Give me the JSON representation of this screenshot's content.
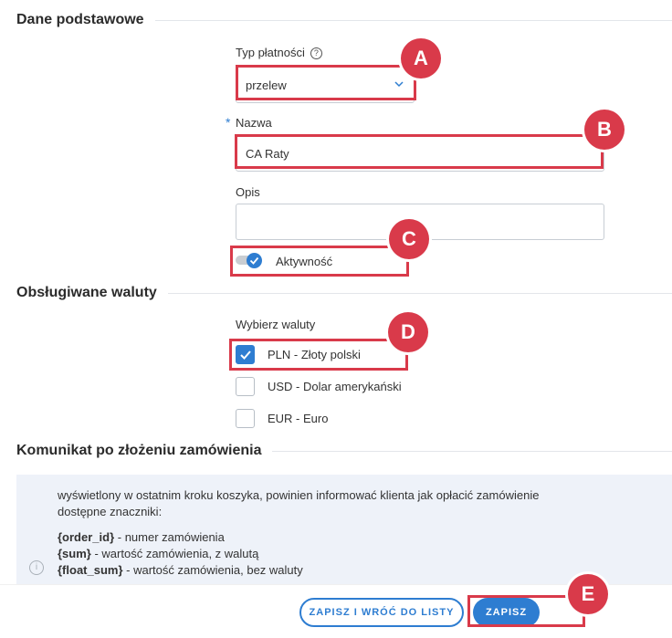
{
  "sections": {
    "basic": "Dane podstawowe",
    "currencies": "Obsługiwane waluty",
    "message": "Komunikat po złożeniu zamówienia"
  },
  "fields": {
    "payment_type_label": "Typ płatności",
    "payment_type_help": "?",
    "payment_type_value": "przelew",
    "name_required_mark": "*",
    "name_label": "Nazwa",
    "name_value": "CA Raty",
    "description_label": "Opis",
    "description_value": "",
    "active_label": "Aktywność",
    "active_on": true
  },
  "currencies": {
    "label": "Wybierz waluty",
    "options": [
      {
        "label": "PLN - Złoty polski",
        "checked": true
      },
      {
        "label": "USD - Dolar amerykański",
        "checked": false
      },
      {
        "label": "EUR - Euro",
        "checked": false
      }
    ]
  },
  "info": {
    "icon": "info-icon",
    "line1": "wyświetlony w ostatnim kroku koszyka, powinien informować klienta jak opłacić zamówienie",
    "line2": "dostępne znaczniki:",
    "tags": [
      {
        "tag": "{order_id}",
        "desc": " - numer zamówienia"
      },
      {
        "tag": "{sum}",
        "desc": " - wartość zamówienia, z walutą"
      },
      {
        "tag": "{float_sum}",
        "desc": " - wartość zamówienia, bez waluty"
      }
    ]
  },
  "buttons": {
    "save_and_back": "ZAPISZ I WRÓĆ DO LISTY",
    "save": "ZAPISZ"
  },
  "annotations": [
    "A",
    "B",
    "C",
    "D",
    "E"
  ],
  "colors": {
    "accent": "#2e7dd1",
    "annotation": "#d93a4a",
    "info_bg": "#eef2f9"
  }
}
